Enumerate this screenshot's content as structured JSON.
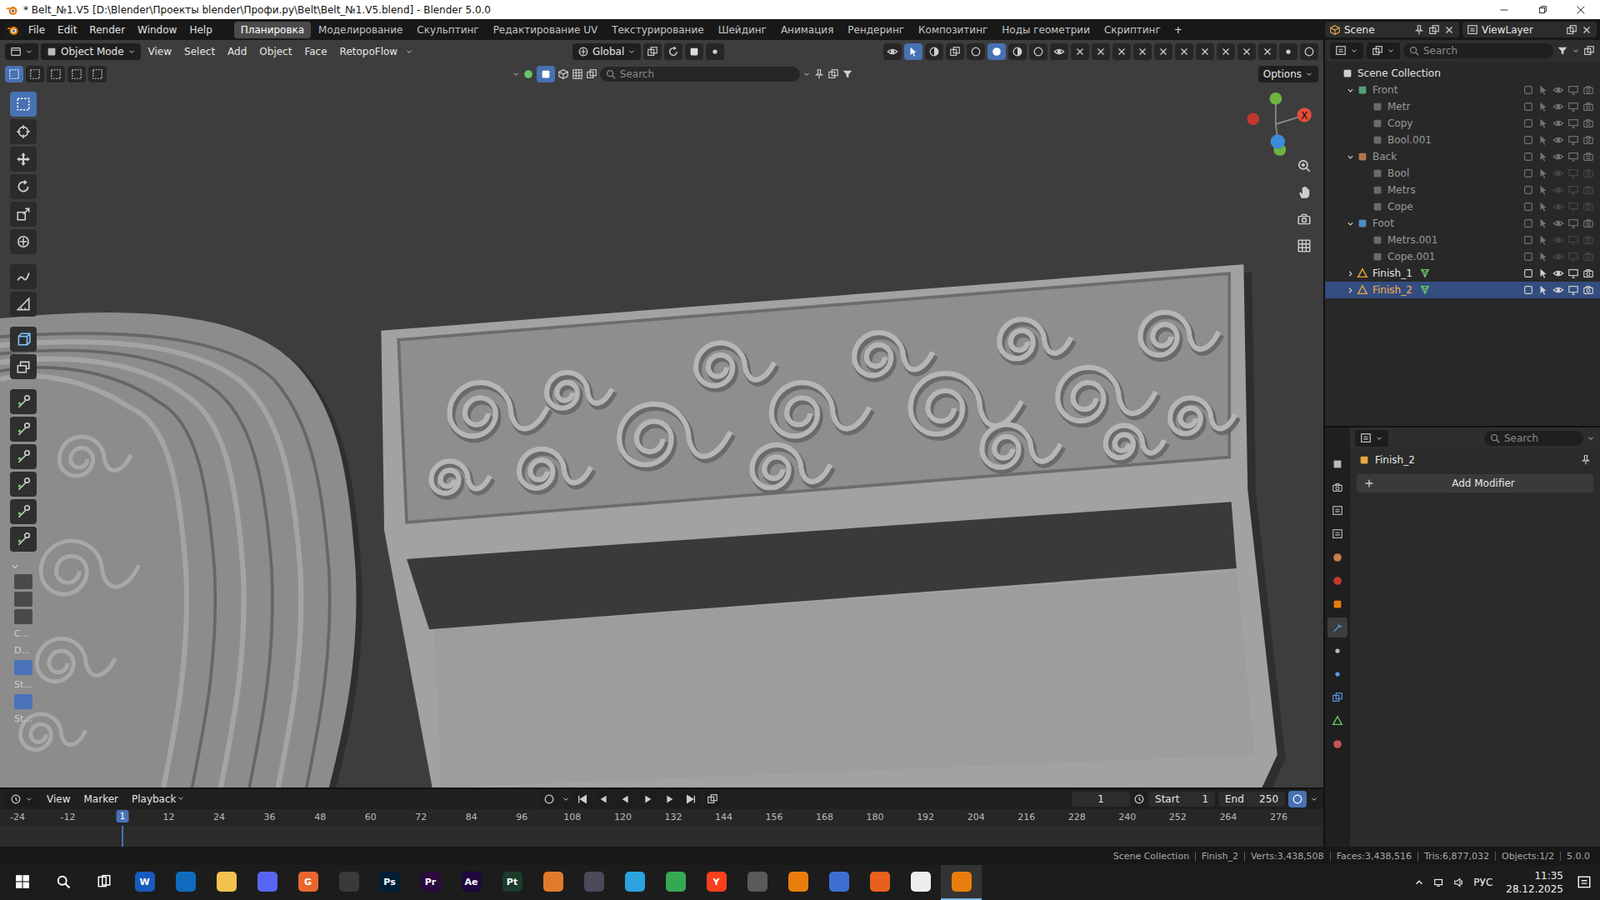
{
  "window": {
    "title": "* Belt_№1.V5 [D:\\Blender\\Проекты blender\\Профи.ру\\Belt\\Belt_№1.V5.blend] - Blender 5.0.0"
  },
  "menu": [
    "File",
    "Edit",
    "Render",
    "Window",
    "Help"
  ],
  "workspaces": [
    {
      "label": "Планировка",
      "selected": true
    },
    {
      "label": "Моделирование",
      "selected": false
    },
    {
      "label": "Скульптинг",
      "selected": false
    },
    {
      "label": "Редактирование UV",
      "selected": false
    },
    {
      "label": "Текстурирование",
      "selected": false
    },
    {
      "label": "Шейдинг",
      "selected": false
    },
    {
      "label": "Анимация",
      "selected": false
    },
    {
      "label": "Рендеринг",
      "selected": false
    },
    {
      "label": "Композитинг",
      "selected": false
    },
    {
      "label": "Ноды геометрии",
      "selected": false
    },
    {
      "label": "Скриптинг",
      "selected": false
    }
  ],
  "add_workspace": "+",
  "scene": "Scene",
  "view_layer": "ViewLayer",
  "viewport": {
    "mode": "Object Mode",
    "menus": [
      "View",
      "Select",
      "Add",
      "Object",
      "Face",
      "RetopoFlow"
    ],
    "orientation": "Global",
    "search_placeholder": "Search",
    "options": "Options",
    "gizmo_x": "X",
    "select_modes": [
      {
        "selected": true
      },
      {
        "selected": false
      },
      {
        "selected": false
      },
      {
        "selected": false
      },
      {
        "selected": false
      }
    ],
    "active_tool": 0,
    "toolbar_labels": [
      "C...",
      "D...",
      "St...",
      "St..."
    ]
  },
  "outliner": {
    "search_placeholder": "Search",
    "rows": [
      {
        "name": "Scene Collection",
        "depth": 0,
        "kind": "scene",
        "expanded": true,
        "selected": false,
        "dimmed": false,
        "visible": true
      },
      {
        "name": "Front",
        "depth": 1,
        "kind": "collection",
        "expanded": true,
        "selected": false,
        "dimmed": true,
        "visible": true,
        "color": "#4fa37a"
      },
      {
        "name": "Metr",
        "depth": 2,
        "kind": "object",
        "expanded": false,
        "selected": false,
        "dimmed": true,
        "visible": true
      },
      {
        "name": "Copy",
        "depth": 2,
        "kind": "object",
        "expanded": false,
        "selected": false,
        "dimmed": true,
        "visible": true
      },
      {
        "name": "Bool.001",
        "depth": 2,
        "kind": "object",
        "expanded": false,
        "selected": false,
        "dimmed": true,
        "visible": true
      },
      {
        "name": "Back",
        "depth": 1,
        "kind": "collection",
        "expanded": true,
        "selected": false,
        "dimmed": true,
        "visible": true,
        "color": "#b0754a"
      },
      {
        "name": "Bool",
        "depth": 2,
        "kind": "object",
        "expanded": false,
        "selected": false,
        "dimmed": true,
        "visible": false
      },
      {
        "name": "Metrs",
        "depth": 2,
        "kind": "object",
        "expanded": false,
        "selected": false,
        "dimmed": true,
        "visible": false
      },
      {
        "name": "Cope",
        "depth": 2,
        "kind": "object",
        "expanded": false,
        "selected": false,
        "dimmed": true,
        "visible": false
      },
      {
        "name": "Foot",
        "depth": 1,
        "kind": "collection",
        "expanded": true,
        "selected": false,
        "dimmed": true,
        "visible": true,
        "color": "#4a8cc4"
      },
      {
        "name": "Metrs.001",
        "depth": 2,
        "kind": "object",
        "expanded": false,
        "selected": false,
        "dimmed": true,
        "visible": false
      },
      {
        "name": "Cope.001",
        "depth": 2,
        "kind": "object",
        "expanded": false,
        "selected": false,
        "dimmed": true,
        "visible": false
      },
      {
        "name": "Finish_1",
        "depth": 1,
        "kind": "mesh",
        "expanded": false,
        "selected": false,
        "dimmed": false,
        "visible": true
      },
      {
        "name": "Finish_2",
        "depth": 1,
        "kind": "mesh",
        "expanded": false,
        "selected": true,
        "dimmed": false,
        "visible": true
      }
    ]
  },
  "properties": {
    "search_placeholder": "Search",
    "object": "Finish_2",
    "add_modifier": "Add Modifier",
    "tabs": [
      {
        "selected": false
      },
      {
        "selected": false
      },
      {
        "selected": false
      },
      {
        "selected": false
      },
      {
        "selected": false
      },
      {
        "selected": false
      },
      {
        "selected": false
      },
      {
        "selected": true
      },
      {
        "selected": false
      },
      {
        "selected": false
      },
      {
        "selected": false
      },
      {
        "selected": false
      },
      {
        "selected": false
      }
    ]
  },
  "timeline": {
    "menus": [
      "View",
      "Marker",
      "Playback"
    ],
    "current_frame": "1",
    "start_label": "Start",
    "start": "1",
    "end_label": "End",
    "end": "250",
    "ticks": [
      "-24",
      "-12",
      "12",
      "24",
      "36",
      "48",
      "60",
      "72",
      "84",
      "96",
      "108",
      "120",
      "132",
      "144",
      "156",
      "168",
      "180",
      "192",
      "204",
      "216",
      "228",
      "240",
      "252",
      "264",
      "276"
    ],
    "playhead": "1"
  },
  "status_bar": [
    "Scene Collection",
    "Finish_2",
    "Verts:3,438,508",
    "Faces:3,438,516",
    "Tris:6,877,032",
    "Objects:1/2",
    "5.0.0"
  ],
  "taskbar": {
    "apps": [
      {
        "color": "#185abd",
        "label": "W",
        "active": false
      },
      {
        "color": "#0f6cbd",
        "active": false
      },
      {
        "color": "#f2c14e",
        "active": false
      },
      {
        "color": "#5865f2",
        "active": false
      },
      {
        "color": "#e8672e",
        "label": "G",
        "active": false
      },
      {
        "color": "#3a3a3a",
        "active": false
      },
      {
        "color": "#001e36",
        "label": "Ps",
        "active": false
      },
      {
        "color": "#2a0a3f",
        "label": "Pr",
        "active": false
      },
      {
        "color": "#1f0740",
        "label": "Ae",
        "active": false
      },
      {
        "color": "#1b3b2b",
        "label": "Pt",
        "active": false
      },
      {
        "color": "#e07b2a",
        "active": false
      },
      {
        "color": "#4a4a5a",
        "active": false
      },
      {
        "color": "#2aa3df",
        "active": false
      },
      {
        "color": "#34a853",
        "active": false
      },
      {
        "color": "#fc3f1d",
        "label": "Y",
        "active": false
      },
      {
        "color": "#5a5a5a",
        "active": false
      },
      {
        "color": "#e87d0d",
        "active": false
      },
      {
        "color": "#3c6fd1",
        "active": false
      },
      {
        "color": "#e8601d",
        "active": false
      },
      {
        "color": "#eeeeee",
        "active": false
      },
      {
        "color": "#e87d0d",
        "active": true
      }
    ],
    "language": "РУС",
    "time": "11:35",
    "date": "28.12.2025"
  }
}
